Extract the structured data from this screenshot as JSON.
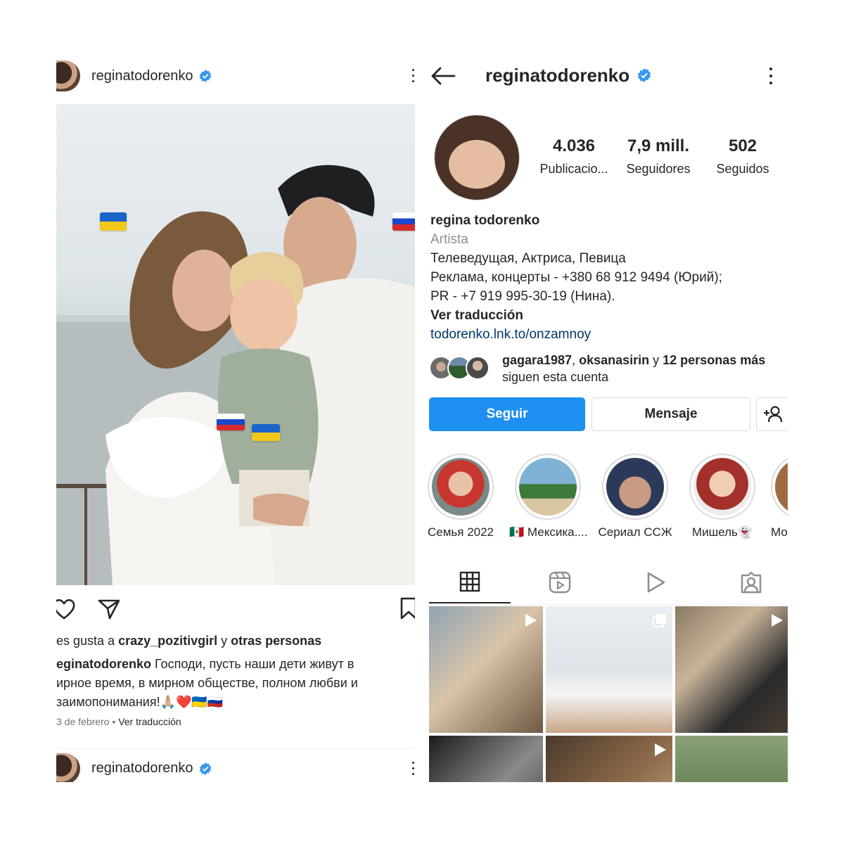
{
  "post": {
    "username": "reginatodorenko",
    "likes_prefix": "es gusta a ",
    "likes_user": "crazy_pozitivgirl",
    "likes_middle": " y ",
    "likes_suffix": "otras personas",
    "caption_user": "eginatodorenko",
    "caption_line1": " Господи, пусть наши дети живут в",
    "caption_line2": "ирное время, в мирном обществе, полном  любви и",
    "caption_line3": "заимопонимания!🙏🏼❤️🇺🇦🇷🇺",
    "date": "3 de febrero",
    "separator": " • ",
    "translate": "Ver traducción",
    "next_username": "reginatodorenko"
  },
  "profile": {
    "username": "reginatodorenko",
    "stats": [
      {
        "value": "4.036",
        "label": "Publicacio..."
      },
      {
        "value": "7,9 mill.",
        "label": "Seguidores"
      },
      {
        "value": "502",
        "label": "Seguidos"
      }
    ],
    "name": "regina todorenko",
    "category": "Artista",
    "bio_line1": "Телеведущая, Актриса, Певица",
    "bio_line2": "Реклама, концерты - +380 68 912 9494 (Юрий);",
    "bio_line3": "PR - +7 919 995-30-19 (Нина).",
    "bio_translate": "Ver traducción",
    "link": "todorenko.lnk.to/onzamnoy",
    "followed_by_user1": "gagara1987",
    "followed_by_sep1": ", ",
    "followed_by_user2": "oksanasirin",
    "followed_by_sep2": " y ",
    "followed_by_more": "12 personas más",
    "followed_by_line2": "siguen esta cuenta",
    "follow_button": "Seguir",
    "message_button": "Mensaje",
    "highlights": [
      {
        "label": "Семья 2022"
      },
      {
        "label": "🇲🇽 Мексика...."
      },
      {
        "label": "Сериал ССЖ"
      },
      {
        "label": "Мишель👻"
      },
      {
        "label": "Мо"
      }
    ]
  },
  "colors": {
    "accent": "#1e90f0",
    "verified": "#3897f0",
    "text": "#262626",
    "muted": "#8e8e8e",
    "link": "#00376b"
  }
}
